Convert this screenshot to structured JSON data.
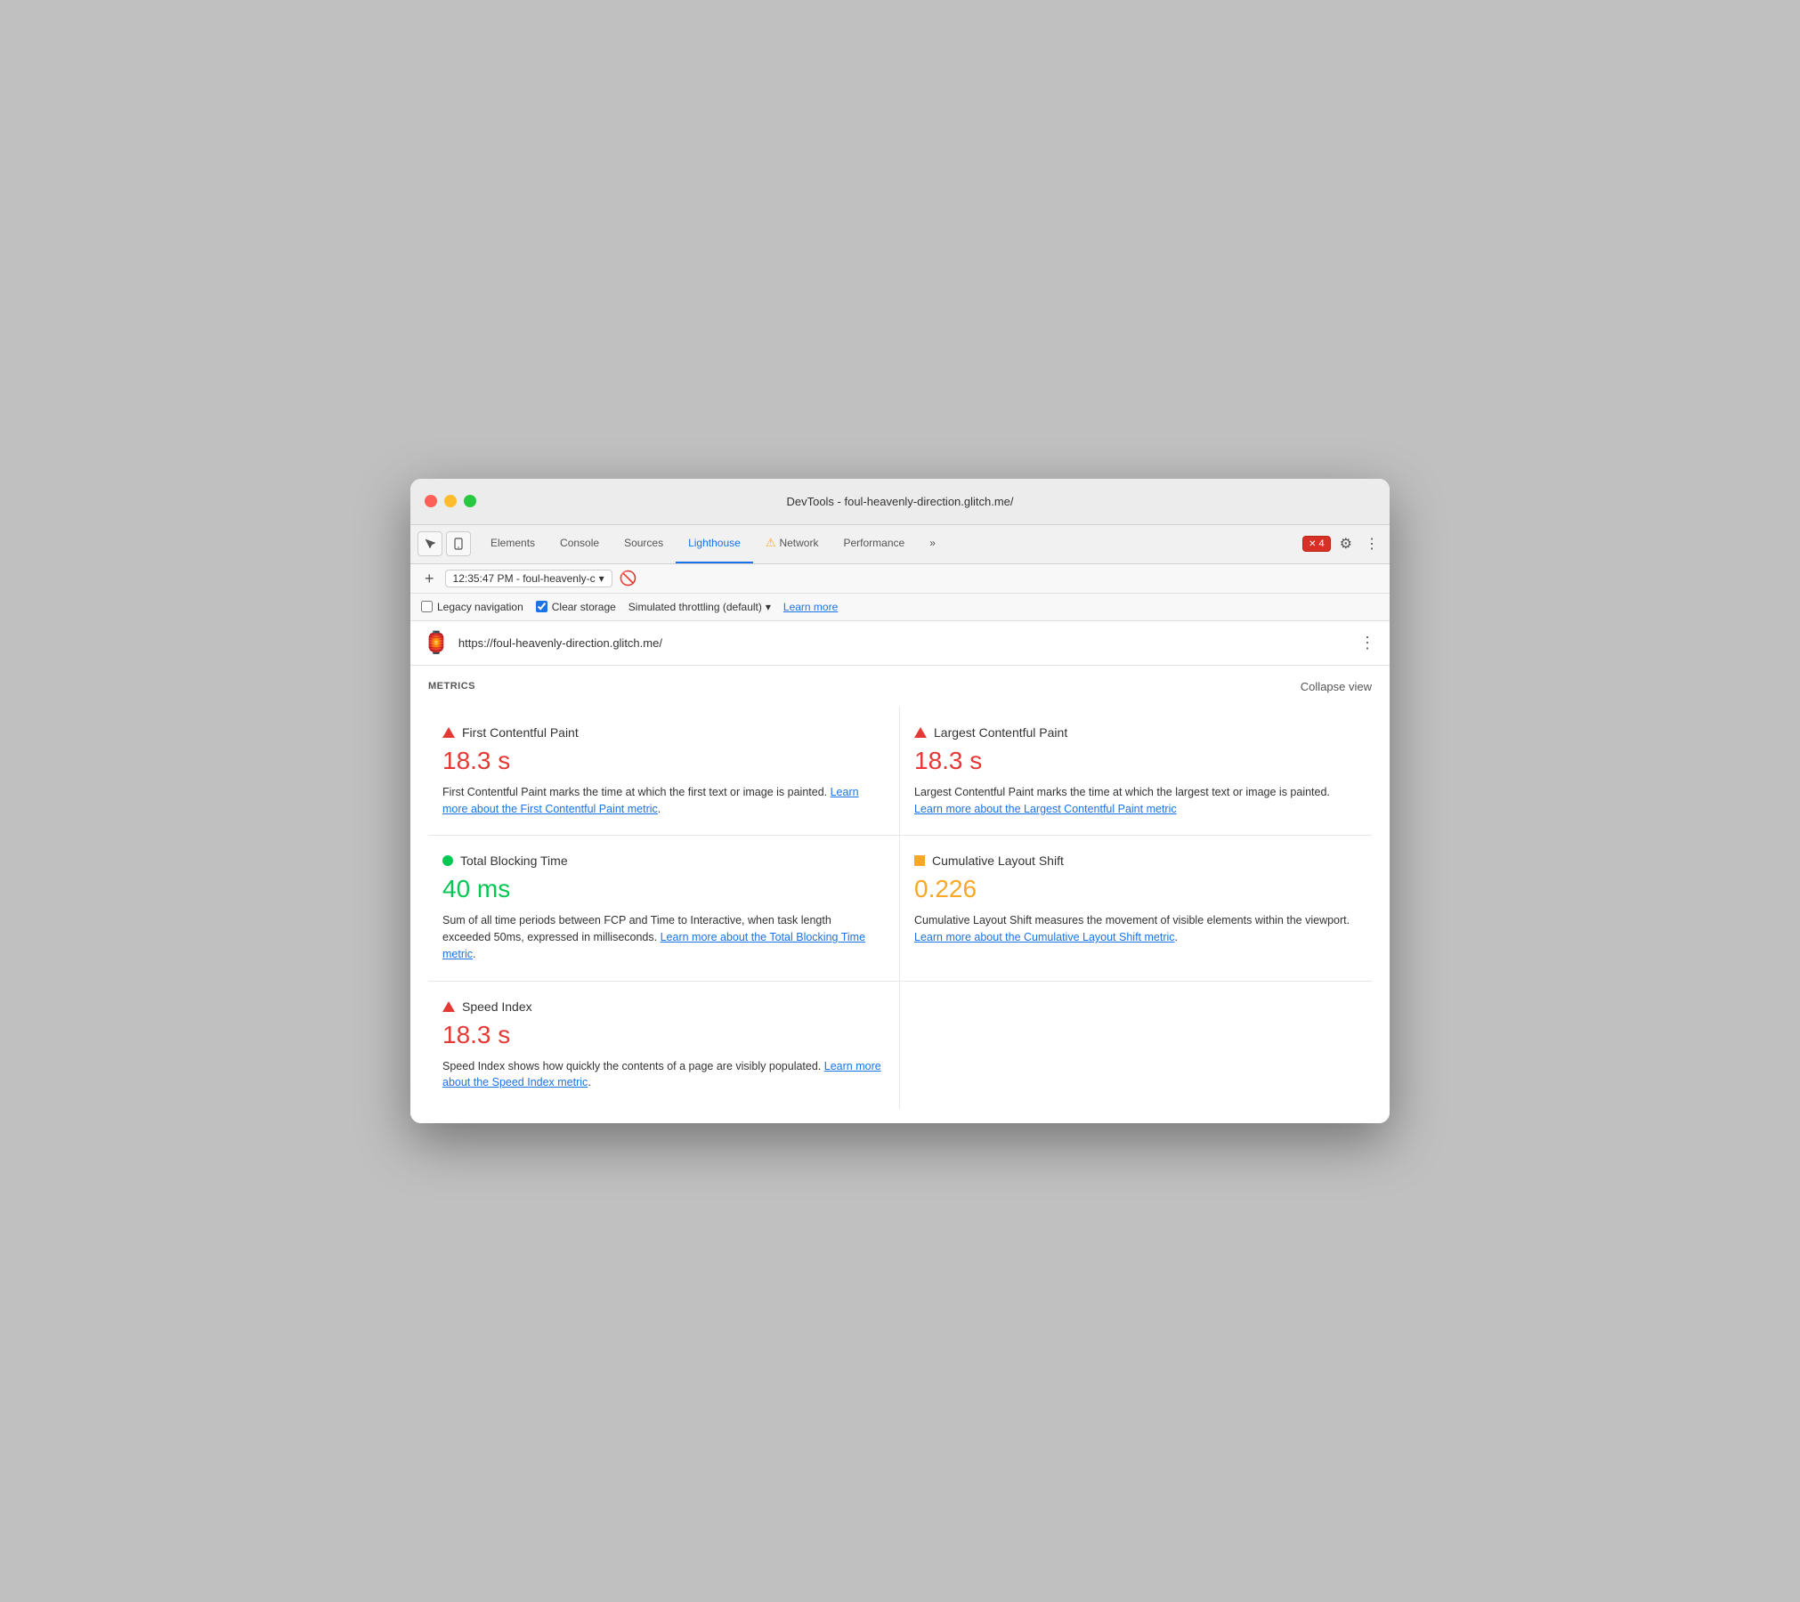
{
  "window": {
    "title": "DevTools - foul-heavenly-direction.glitch.me/"
  },
  "tabs": [
    {
      "id": "elements",
      "label": "Elements",
      "active": false,
      "warning": false
    },
    {
      "id": "console",
      "label": "Console",
      "active": false,
      "warning": false
    },
    {
      "id": "sources",
      "label": "Sources",
      "active": false,
      "warning": false
    },
    {
      "id": "lighthouse",
      "label": "Lighthouse",
      "active": true,
      "warning": false
    },
    {
      "id": "network",
      "label": "Network",
      "active": false,
      "warning": true
    },
    {
      "id": "performance",
      "label": "Performance",
      "active": false,
      "warning": false
    }
  ],
  "toolbar": {
    "more_tabs": "»",
    "error_count": "4",
    "plus_label": "+",
    "session_time": "12:35:47 PM - foul-heavenly-c",
    "dropdown_arrow": "▾"
  },
  "options": {
    "legacy_nav_label": "Legacy navigation",
    "legacy_nav_checked": false,
    "clear_storage_label": "Clear storage",
    "clear_storage_checked": true,
    "throttling_label": "Simulated throttling (default)",
    "learn_more_label": "Learn more"
  },
  "url_bar": {
    "url": "https://foul-heavenly-direction.glitch.me/",
    "more_options": "⋮"
  },
  "metrics": {
    "title": "METRICS",
    "collapse_label": "Collapse view",
    "items": [
      {
        "id": "fcp",
        "indicator": "triangle-red",
        "name": "First Contentful Paint",
        "value": "18.3 s",
        "value_color": "red",
        "description": "First Contentful Paint marks the time at which the first text or image is painted.",
        "learn_more_text": "Learn more about the First Contentful Paint metric",
        "learn_more_suffix": "."
      },
      {
        "id": "lcp",
        "indicator": "triangle-red",
        "name": "Largest Contentful Paint",
        "value": "18.3 s",
        "value_color": "red",
        "description": "Largest Contentful Paint marks the time at which the largest text or image is painted.",
        "learn_more_text": "Learn more about the Largest Contentful Paint metric",
        "learn_more_suffix": ""
      },
      {
        "id": "tbt",
        "indicator": "circle-green",
        "name": "Total Blocking Time",
        "value": "40 ms",
        "value_color": "green",
        "description": "Sum of all time periods between FCP and Time to Interactive, when task length exceeded 50ms, expressed in milliseconds.",
        "learn_more_text": "Learn more about the Total Blocking Time metric",
        "learn_more_suffix": "."
      },
      {
        "id": "cls",
        "indicator": "square-orange",
        "name": "Cumulative Layout Shift",
        "value": "0.226",
        "value_color": "orange",
        "description": "Cumulative Layout Shift measures the movement of visible elements within the viewport.",
        "learn_more_text": "Learn more about the Cumulative Layout Shift metric",
        "learn_more_suffix": "."
      }
    ],
    "speed_index": {
      "id": "si",
      "indicator": "triangle-red",
      "name": "Speed Index",
      "value": "18.3 s",
      "value_color": "red",
      "description": "Speed Index shows how quickly the contents of a page are visibly populated.",
      "learn_more_text": "Learn more about the Speed Index metric",
      "learn_more_suffix": "."
    }
  }
}
